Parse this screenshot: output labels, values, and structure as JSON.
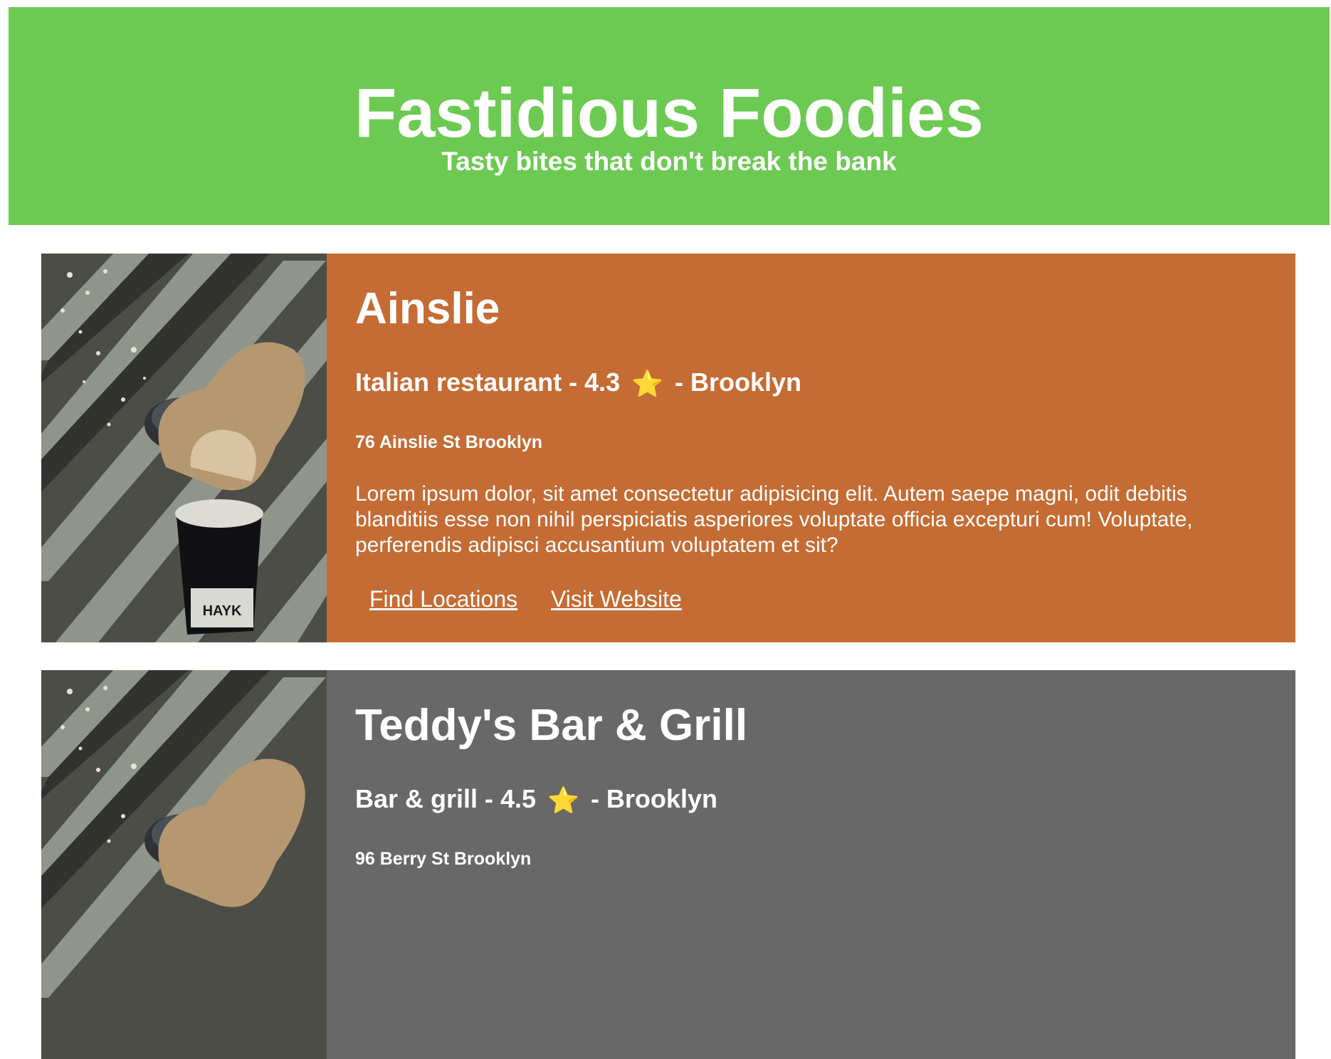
{
  "header": {
    "title": "Fastidious Foodies",
    "tagline": "Tasty bites that don't break the bank"
  },
  "colors": {
    "header_bg": "#6cca52",
    "card_1_bg": "#c46c34",
    "card_2_bg": "#686868",
    "text": "#ffffff"
  },
  "restaurants": [
    {
      "name": "Ainslie",
      "meta_prefix": "Italian restaurant - 4.3",
      "star": "⭐",
      "meta_suffix": "- Brooklyn",
      "address": "76 Ainslie St Brooklyn",
      "description": "Lorem ipsum dolor, sit amet consectetur adipisicing elit. Autem saepe magni, odit debitis blanditiis esse non nihil perspiciatis asperiores voluptate officia excepturi cum! Voluptate, perferendis adipisci accusantium voluptatem et sit?",
      "link_locations": "Find Locations",
      "link_website": "Visit Website",
      "image_icon": "coffee-cup-splash-photo",
      "cup_label": "HAYK"
    },
    {
      "name": "Teddy's Bar & Grill",
      "meta_prefix": "Bar & grill - 4.5",
      "star": "⭐",
      "meta_suffix": "- Brooklyn",
      "address": "96 Berry St Brooklyn",
      "image_icon": "coffee-cup-splash-photo"
    }
  ]
}
